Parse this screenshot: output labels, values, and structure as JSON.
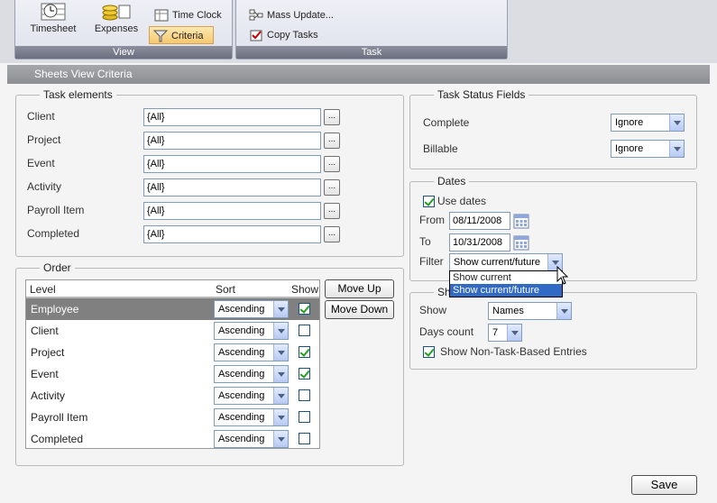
{
  "ribbon": {
    "groups": [
      {
        "caption": "View"
      },
      {
        "caption": "Task"
      }
    ],
    "timesheet_label": "Timesheet",
    "expenses_label": "Expenses",
    "time_clock_label": "Time Clock",
    "criteria_label": "Criteria",
    "mass_update_label": "Mass Update...",
    "copy_tasks_label": "Copy Tasks"
  },
  "title": "Sheets View Criteria",
  "task_elements": {
    "legend": "Task elements",
    "rows": [
      {
        "label": "Client",
        "value": "{All}",
        "button": "..."
      },
      {
        "label": "Project",
        "value": "{All}",
        "button": "..."
      },
      {
        "label": "Event",
        "value": "{All}",
        "button": "..."
      },
      {
        "label": "Activity",
        "value": "{All}",
        "button": "..."
      },
      {
        "label": "Payroll Item",
        "value": "{All}",
        "button": "..."
      },
      {
        "label": "Completed",
        "value": "{All}",
        "button": "..."
      }
    ]
  },
  "order": {
    "legend": "Order",
    "columns": {
      "level": "Level",
      "sort": "Sort",
      "show": "Show"
    },
    "rows": [
      {
        "level": "Employee",
        "sort": "Ascending",
        "show": true,
        "selected": true
      },
      {
        "level": "Client",
        "sort": "Ascending",
        "show": false
      },
      {
        "level": "Project",
        "sort": "Ascending",
        "show": true
      },
      {
        "level": "Event",
        "sort": "Ascending",
        "show": true
      },
      {
        "level": "Activity",
        "sort": "Ascending",
        "show": false
      },
      {
        "level": "Payroll Item",
        "sort": "Ascending",
        "show": false
      },
      {
        "level": "Completed",
        "sort": "Ascending",
        "show": false
      }
    ],
    "move_up_label": "Move Up",
    "move_down_label": "Move Down"
  },
  "task_status": {
    "legend": "Task Status Fields",
    "complete_label": "Complete",
    "complete_value": "Ignore",
    "billable_label": "Billable",
    "billable_value": "Ignore"
  },
  "dates": {
    "legend": "Dates",
    "use_dates_label": "Use dates",
    "use_dates_checked": true,
    "from_label": "From",
    "from_value": "08/11/2008",
    "to_label": "To",
    "to_value": "10/31/2008",
    "filter_label": "Filter",
    "filter_value": "Show current/future",
    "filter_options": [
      "Show current",
      "Show current/future"
    ]
  },
  "show_section": {
    "legend": "Sh",
    "show_label": "Show",
    "show_value": "Names",
    "days_count_label": "Days count",
    "days_count_value": "7",
    "non_task_label": "Show Non-Task-Based Entries",
    "non_task_checked": true
  },
  "save_label": "Save",
  "colors": {
    "selected_row": "#808080",
    "dropdown_highlight": "#316ac5",
    "titlebar": "#999a9f"
  }
}
